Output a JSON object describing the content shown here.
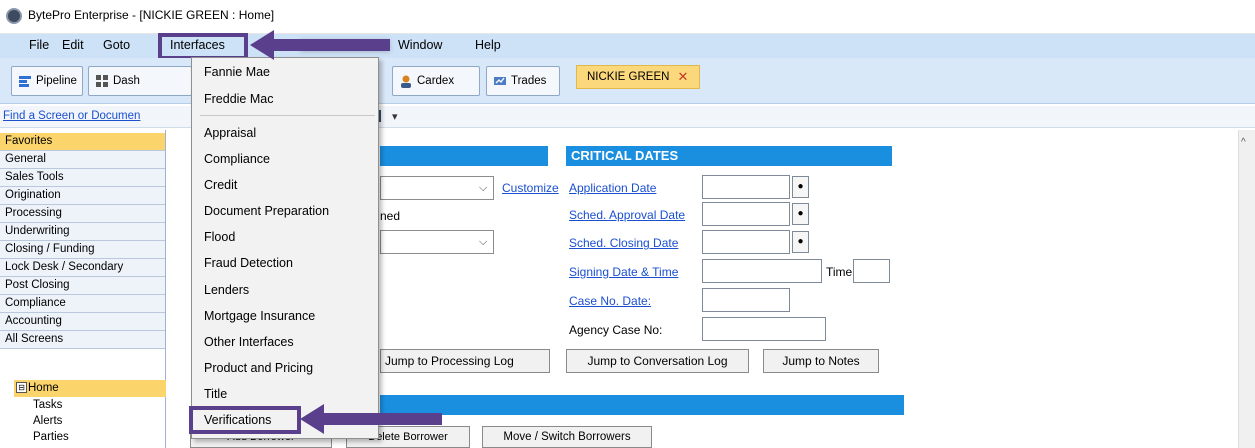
{
  "window": {
    "title": "BytePro Enterprise - [NICKIE GREEN : Home]"
  },
  "menu": {
    "file": "File",
    "edit": "Edit",
    "goto": "Goto",
    "interfaces": "Interfaces",
    "window": "Window",
    "help": "Help"
  },
  "toolbar": {
    "pipeline": "Pipeline",
    "dashboard": "Dash",
    "cardex": "Cardex",
    "trades": "Trades",
    "open_tab": "NICKIE GREEN",
    "close_glyph": "✕"
  },
  "find_link": "Find a Screen or Documen",
  "sidebar": {
    "items": [
      {
        "label": "Favorites",
        "active": true
      },
      {
        "label": "General"
      },
      {
        "label": "Sales Tools"
      },
      {
        "label": "Origination"
      },
      {
        "label": "Processing"
      },
      {
        "label": "Underwriting"
      },
      {
        "label": "Closing / Funding"
      },
      {
        "label": "Lock Desk / Secondary"
      },
      {
        "label": "Post Closing"
      },
      {
        "label": "Compliance"
      },
      {
        "label": "Accounting"
      },
      {
        "label": "All Screens"
      }
    ],
    "home": "Home",
    "home_toggle": "⊟",
    "sub_items": [
      "Tasks",
      "Alerts",
      "Parties"
    ]
  },
  "main": {
    "customize": "Customize",
    "assigned_partial": "ned",
    "critical_dates": {
      "title": "CRITICAL DATES",
      "application_date": "Application Date",
      "sched_approval_date": "Sched. Approval Date",
      "sched_closing_date": "Sched. Closing Date",
      "signing_date_time": "Signing Date & Time",
      "time_label": "Time:",
      "case_no_date": "Case No. Date:",
      "agency_case_no": "Agency Case No:",
      "dot": "●"
    },
    "buttons": {
      "processing_log": "Jump to Processing Log",
      "conversation_log": "Jump to Conversation Log",
      "notes": "Jump to Notes",
      "add_borrower": "Add Borrower",
      "delete_borrower": "Delete Borrower",
      "move_switch": "Move / Switch Borrowers"
    }
  },
  "interfaces_menu": {
    "items": [
      "Fannie Mae",
      "Freddie Mac",
      "Appraisal",
      "Compliance",
      "Credit",
      "Document Preparation",
      "Flood",
      "Fraud Detection",
      "Lenders",
      "Mortgage Insurance",
      "Other Interfaces",
      "Product and Pricing",
      "Title",
      "Verifications"
    ]
  },
  "colors": {
    "accent_purple": "#5a3f8c",
    "section_blue": "#1a8fe0",
    "favorite_yellow": "#fbd56b",
    "menubar_blue": "#cde1f7"
  }
}
